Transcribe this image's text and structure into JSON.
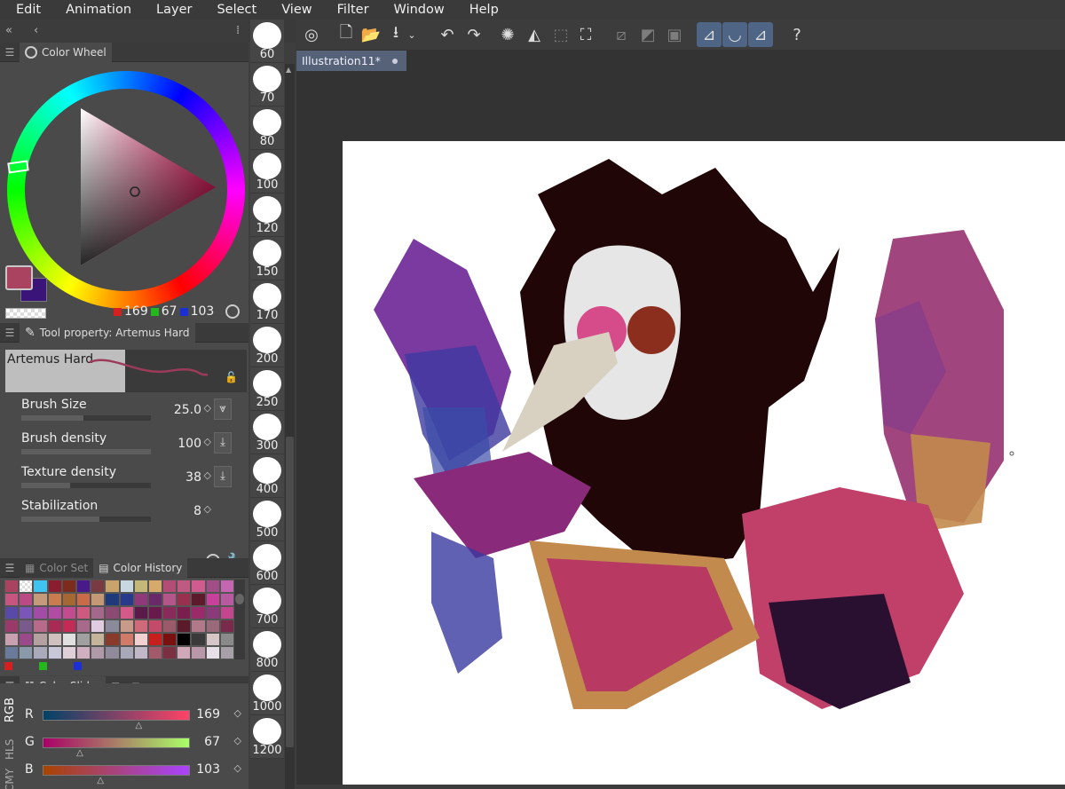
{
  "menu": [
    "Edit",
    "Animation",
    "Layer",
    "Select",
    "View",
    "Filter",
    "Window",
    "Help"
  ],
  "color_wheel": {
    "title": "Color Wheel",
    "main_color": "#a9435f",
    "sub_color": "#3a1478",
    "rgb": {
      "r": "169",
      "g": "67",
      "b": "103"
    },
    "r_color": "#d61f1f",
    "g_color": "#22b81e",
    "b_color": "#1b2fd6"
  },
  "tool_property": {
    "title": "Tool property: Artemus Hard",
    "brush_name": "Artemus Hard",
    "props": [
      {
        "label": "Brush Size",
        "value": "25.0",
        "fill": 0.48
      },
      {
        "label": "Brush density",
        "value": "100",
        "fill": 1.0
      },
      {
        "label": "Texture density",
        "value": "38",
        "fill": 0.38
      },
      {
        "label": "Stabilization",
        "value": "8",
        "fill": 0.6
      }
    ]
  },
  "color_history": {
    "tab_set": "Color Set",
    "tab_history": "Color History",
    "colors": [
      "#a9435f",
      "#ffffff",
      "#3fc3f0",
      "#8b1e2e",
      "#7d2b1c",
      "#4a1a8b",
      "#7a3a42",
      "#c8a46a",
      "#c9d8e0",
      "#c4b77a",
      "#d6a96d",
      "#b34d76",
      "#c05a82",
      "#cf5c8d",
      "#a14e86",
      "#c565b2",
      "#c4567f",
      "#b94a83",
      "#c59a7a",
      "#c97d4e",
      "#a56832",
      "#c96a49",
      "#c49a76",
      "#1f3a7a",
      "#2a3a8a",
      "#8e3a7a",
      "#6a2a6a",
      "#b4568a",
      "#98304e",
      "#5c1a2a",
      "#c8409a",
      "#b85aa0",
      "#5a4aa8",
      "#7a56b8",
      "#a34ca6",
      "#b04ca4",
      "#c24c90",
      "#cf5a80",
      "#a3688a",
      "#8a4a72",
      "#d45a8a",
      "#5a1a4a",
      "#6a1a4a",
      "#8a2a5a",
      "#7a1e4e",
      "#9a2a6a",
      "#8a3a7a",
      "#c4468e",
      "#9a3a6a",
      "#7a5a8a",
      "#b86a8a",
      "#aa2a56",
      "#c42a56",
      "#a86a8a",
      "#e0cce0",
      "#8a8a9a",
      "#c89a8a",
      "#d06a7a",
      "#c44a6a",
      "#9a5a6a",
      "#5a1a2a",
      "#b07a8a",
      "#9a6a7a",
      "#7a2a4a",
      "#c8a0b0",
      "#9a4a8a",
      "#b4a0a0",
      "#d0c0c0",
      "#e0e0e0",
      "#a0a0a0",
      "#c6b49a",
      "#8a3a2a",
      "#d07a6a",
      "#f0d0d0",
      "#c81e1e",
      "#7a1010",
      "#000000",
      "#3a3a3a",
      "#d6c6c6",
      "#8a8a8a",
      "#6a7a9a",
      "#8a9aaa",
      "#aaaabb",
      "#c8c8d8",
      "#e0d0d8",
      "#d0b0c0",
      "#b09aaa",
      "#908a9a",
      "#a8a8b8",
      "#c0b8c8",
      "#a05a6a",
      "#7a3040",
      "#d0a8b8",
      "#b898a8",
      "#e8e0e8",
      "#a8a0a8"
    ]
  },
  "color_slider": {
    "title": "Color Slider",
    "mode_tabs": [
      "RGB",
      "HLS",
      "CMY"
    ],
    "rows": [
      {
        "label": "R",
        "value": "169",
        "fill": 0.66
      },
      {
        "label": "G",
        "value": "67",
        "fill": 0.26
      },
      {
        "label": "B",
        "value": "103",
        "fill": 0.4
      }
    ]
  },
  "brush_sizes": [
    "60",
    "70",
    "80",
    "100",
    "120",
    "150",
    "170",
    "200",
    "250",
    "300",
    "400",
    "500",
    "600",
    "700",
    "800",
    "1000",
    "1200"
  ],
  "document": {
    "tab_title": "Illustration11*"
  }
}
